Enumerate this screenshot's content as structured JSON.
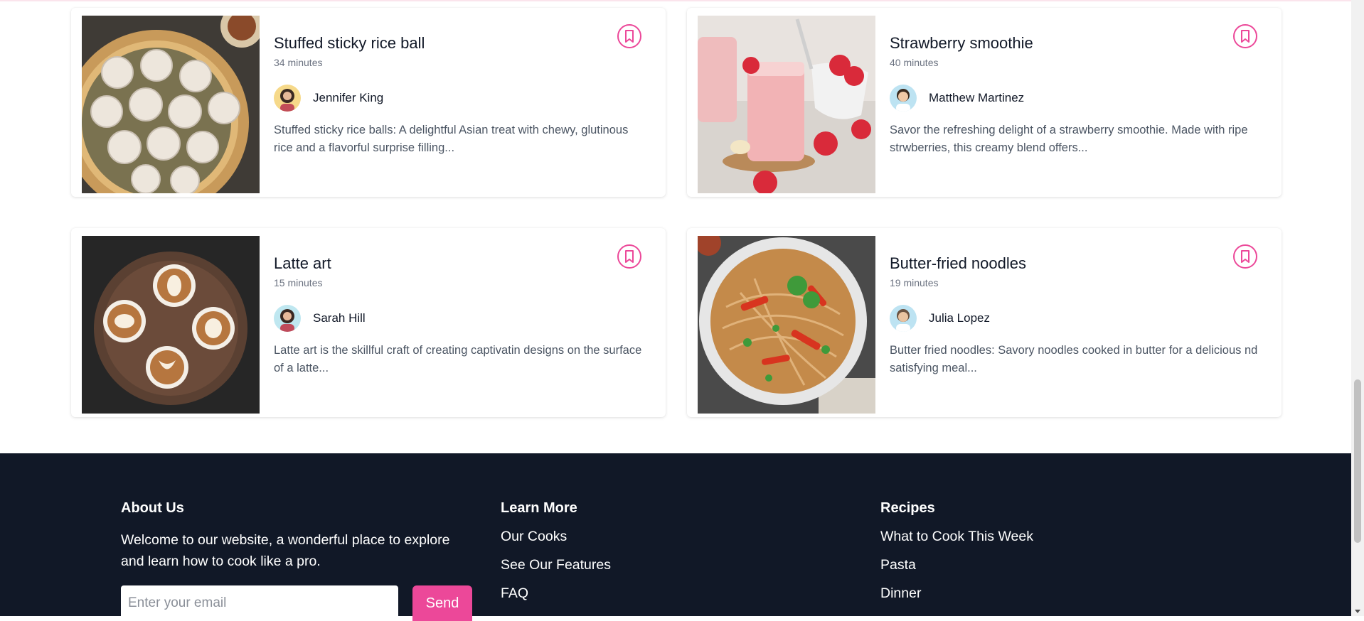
{
  "recipes": [
    {
      "title": "Stuffed sticky rice ball",
      "time": "34 minutes",
      "author": "Jennifer King",
      "description": "Stuffed sticky rice balls: A delightful Asian treat with chewy, glutinous rice and a flavorful surprise filling..."
    },
    {
      "title": "Strawberry smoothie",
      "time": "40 minutes",
      "author": "Matthew Martinez",
      "description": "Savor the refreshing delight of a strawberry smoothie. Made with ripe strwberries, this creamy blend offers..."
    },
    {
      "title": "Latte art",
      "time": "15 minutes",
      "author": "Sarah Hill",
      "description": "Latte art is the skillful craft of creating captivatin designs on the surface of a latte..."
    },
    {
      "title": "Butter-fried noodles",
      "time": "19 minutes",
      "author": "Julia Lopez",
      "description": "Butter fried noodles: Savory noodles cooked in butter for a delicious nd satisfying meal..."
    }
  ],
  "footer": {
    "about": {
      "heading": "About Us",
      "text": "Welcome to our website, a wonderful place to explore and learn how to cook like a pro.",
      "email_placeholder": "Enter your email",
      "send_label": "Send"
    },
    "learn_more": {
      "heading": "Learn More",
      "links": [
        "Our Cooks",
        "See Our Features",
        "FAQ"
      ]
    },
    "recipes": {
      "heading": "Recipes",
      "links": [
        "What to Cook This Week",
        "Pasta",
        "Dinner"
      ]
    }
  },
  "colors": {
    "accent": "#ec4899",
    "footer_bg": "#111827"
  },
  "icons": {
    "bookmark": "bookmark-icon"
  }
}
